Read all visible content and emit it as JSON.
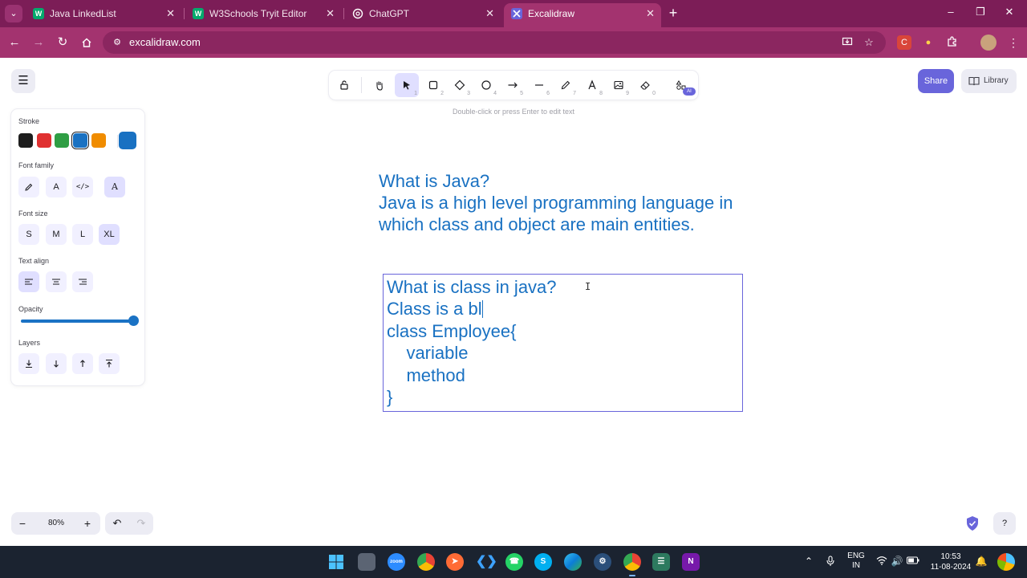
{
  "browser": {
    "tabs": [
      {
        "title": "Java LinkedList",
        "favicon": "W",
        "favicon_color": "#04aa6d",
        "active": false
      },
      {
        "title": "W3Schools Tryit Editor",
        "favicon": "W",
        "favicon_color": "#04aa6d",
        "active": false
      },
      {
        "title": "ChatGPT",
        "favicon": "chatgpt-icon",
        "favicon_color": "#ffffff",
        "active": false
      },
      {
        "title": "Excalidraw",
        "favicon": "excalidraw-icon",
        "favicon_color": "#6965db",
        "active": true
      }
    ],
    "url": "excalidraw.com",
    "theme_color": "#7c1d57"
  },
  "excalidraw": {
    "toolbar": {
      "tools": [
        {
          "name": "lock",
          "key": ""
        },
        {
          "name": "hand",
          "key": ""
        },
        {
          "name": "selection",
          "key": "1",
          "active": true
        },
        {
          "name": "rectangle",
          "key": "2"
        },
        {
          "name": "diamond",
          "key": "3"
        },
        {
          "name": "ellipse",
          "key": "4"
        },
        {
          "name": "arrow",
          "key": "5"
        },
        {
          "name": "line",
          "key": "6"
        },
        {
          "name": "draw",
          "key": "7"
        },
        {
          "name": "text",
          "key": "8"
        },
        {
          "name": "image",
          "key": "9"
        },
        {
          "name": "eraser",
          "key": "0"
        },
        {
          "name": "extra-tools",
          "key": ""
        }
      ],
      "ai_badge": "AI"
    },
    "hint": "Double-click or press Enter to edit text",
    "share_label": "Share",
    "library_label": "Library",
    "panel": {
      "stroke_label": "Stroke",
      "stroke_colors": [
        "#1e1e1e",
        "#e03131",
        "#2f9e44",
        "#1971c2",
        "#f08c00"
      ],
      "stroke_selected": "#1971c2",
      "font_family_label": "Font family",
      "font_size_label": "Font size",
      "font_sizes": [
        "S",
        "M",
        "L",
        "XL"
      ],
      "font_size_selected": "XL",
      "text_align_label": "Text align",
      "opacity_label": "Opacity",
      "opacity_value": 100,
      "layers_label": "Layers"
    },
    "canvas": {
      "text1": "What is Java?\nJava is a high level programming language in\nwhich class and object are main entities.",
      "text2_before_caret": "What is class in java?\nClass is a bl",
      "text2_after_caret": "\nclass Employee{\n    variable\n    method\n}",
      "text_color": "#1971c2"
    },
    "zoom": "80%"
  },
  "taskbar": {
    "lang_line1": "ENG",
    "lang_line2": "IN",
    "time": "10:53",
    "date": "11-08-2024"
  }
}
